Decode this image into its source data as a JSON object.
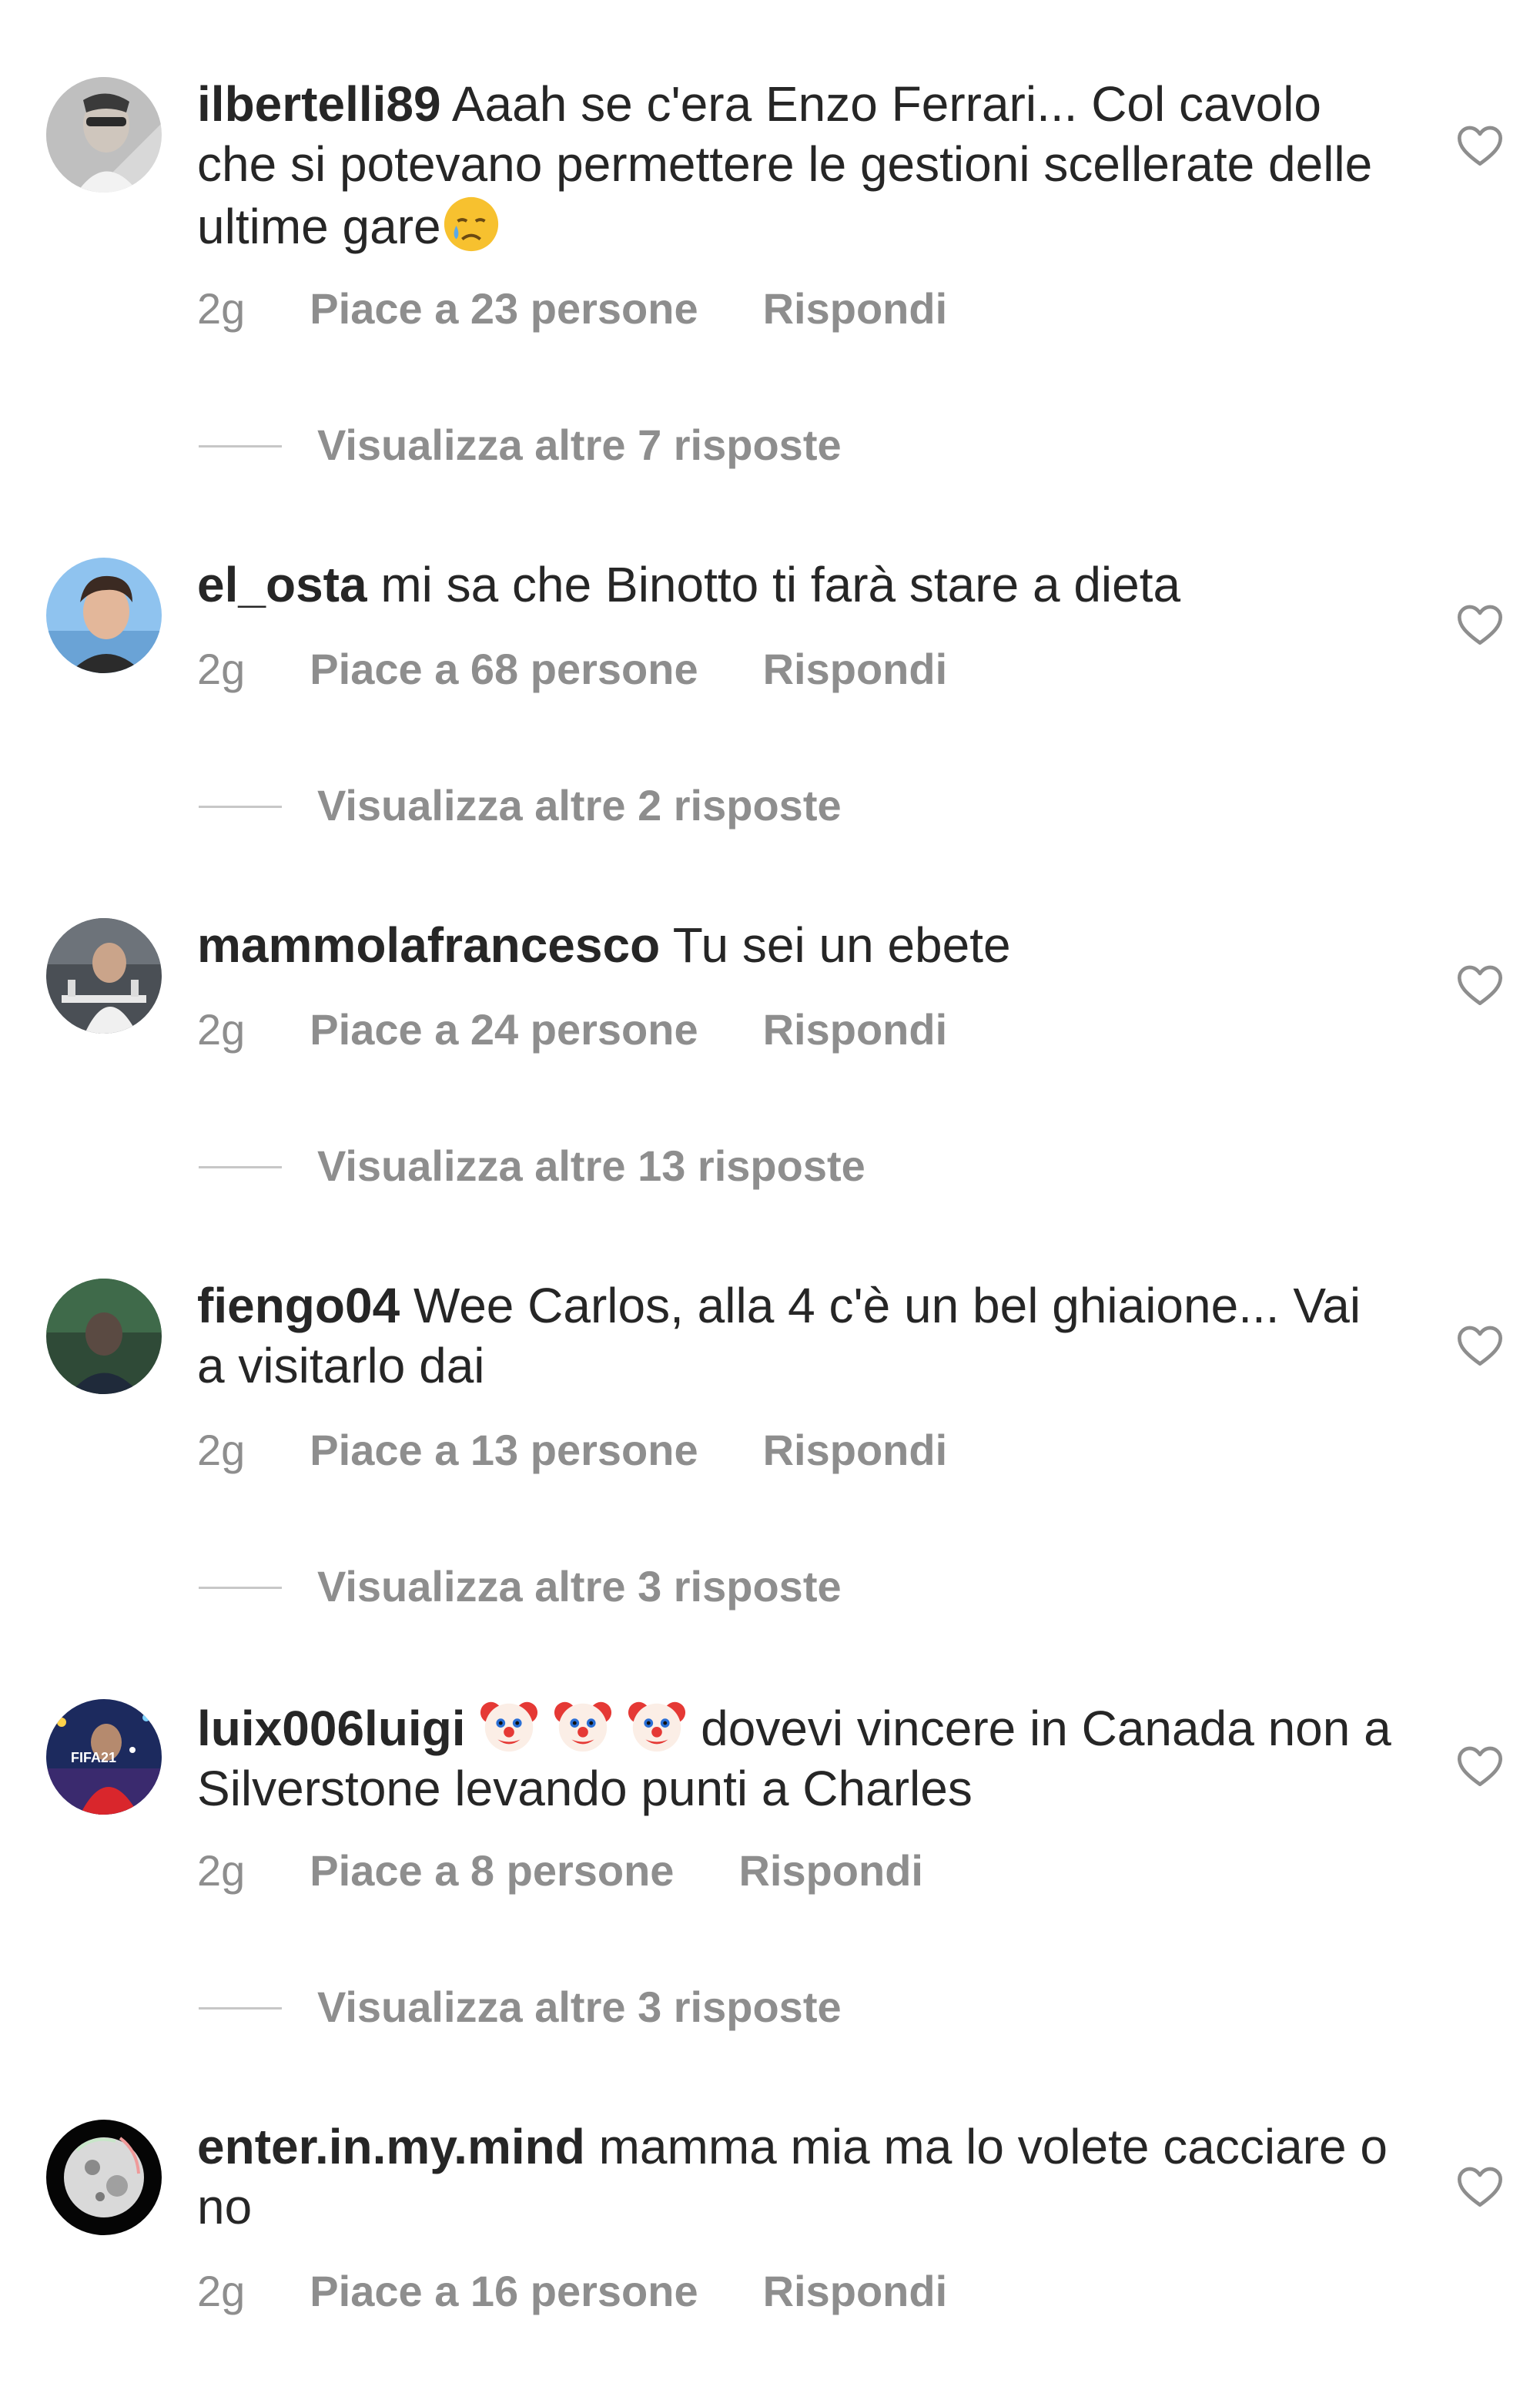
{
  "comments": [
    {
      "username": "ilbertelli89",
      "text": " Aaah se c'era Enzo Ferrari... Col cavolo che si potevano permettere le gestioni scellerate delle ultime gare",
      "emoji": "crying-face",
      "time": "2g",
      "likes": "Piace a 23 persone",
      "reply": "Rispondi",
      "view_replies": "Visualizza altre 7 risposte"
    },
    {
      "username": "el_osta",
      "text": " mi sa che Binotto ti farà stare a dieta",
      "time": "2g",
      "likes": "Piace a 68 persone",
      "reply": "Rispondi",
      "view_replies": "Visualizza altre 2 risposte"
    },
    {
      "username": "mammolafrancesco",
      "text": " Tu sei un ebete",
      "time": "2g",
      "likes": "Piace a 24 persone",
      "reply": "Rispondi",
      "view_replies": "Visualizza altre 13 risposte"
    },
    {
      "username": "fiengo04",
      "text": " Wee Carlos, alla 4 c'è un bel ghiaione... Vai a visitarlo dai",
      "time": "2g",
      "likes": "Piace a 13 persone",
      "reply": "Rispondi",
      "view_replies": "Visualizza altre 3 risposte"
    },
    {
      "username": "luix006luigi",
      "emoji_prefix": "clown-face x3",
      "text": " dovevi vincere in Canada non a Silverstone levando punti a Charles",
      "avatar_badge": "FIFA21",
      "time": "2g",
      "likes": "Piace a 8 persone",
      "reply": "Rispondi",
      "view_replies": "Visualizza altre 3 risposte"
    },
    {
      "username": "enter.in.my.mind",
      "text": " mamma mia ma lo volete cacciare o no",
      "time": "2g",
      "likes": "Piace a 16 persone",
      "reply": "Rispondi"
    }
  ],
  "icons": {
    "like": "heart-outline-icon"
  },
  "colors": {
    "text": "#262626",
    "secondary": "#8e8e8e",
    "divider": "#c7c7c7",
    "background": "#ffffff"
  }
}
